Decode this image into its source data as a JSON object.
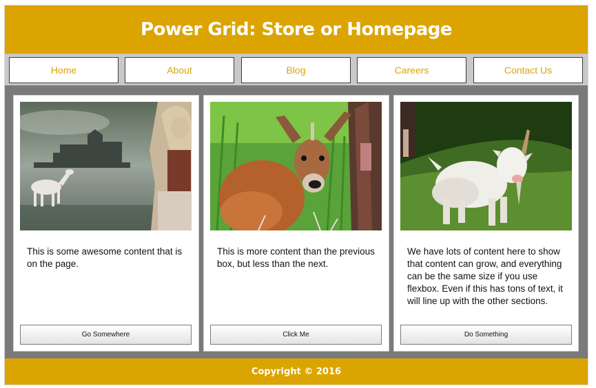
{
  "header": {
    "title": "Power Grid: Store or Homepage"
  },
  "nav": {
    "items": [
      {
        "label": "Home"
      },
      {
        "label": "About"
      },
      {
        "label": "Blog"
      },
      {
        "label": "Careers"
      },
      {
        "label": "Contact Us"
      }
    ]
  },
  "cards": [
    {
      "image": "castle-unicorn-woman-photo",
      "text": "This is some awesome content that is on the page.",
      "button": "Go Somewhere"
    },
    {
      "image": "young-deer-photo",
      "text": "This is more content than the previous box, but less than the next.",
      "button": "Click Me"
    },
    {
      "image": "white-goat-on-grass-photo",
      "text": "We have lots of content here to show that content can grow, and everything can be the same size if you use flexbox. Even if this has tons of text, it will line up with the other sections.",
      "button": "Do Something"
    }
  ],
  "footer": {
    "text": "Copyright © 2016"
  },
  "colors": {
    "brand": "#dca400",
    "nav_bg": "#c9c9c9",
    "main_bg": "#7a7a7a"
  }
}
